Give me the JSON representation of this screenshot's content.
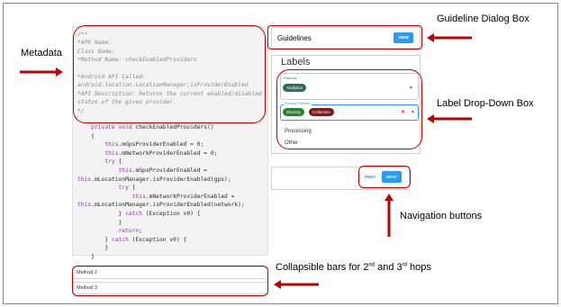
{
  "metadata_code_lines": [
    "/**",
    "*APK Name:",
    "Class Name:",
    "*Method Name: checkEnabledProviders",
    "",
    "*Android API Called:",
    "android.location.LocationManager;isProviderEnabled",
    "*API Description: Returns the current enabled/disabled",
    "status of the given provider.",
    "*/"
  ],
  "code_body_lines": [
    "    private void checkEnabledProviders()",
    "    {",
    "        this.mGpsProviderEnabled = 0;",
    "        this.mNetworkProviderEnabled = 0;",
    "        try {",
    "            this.mGpsProviderEnabled =",
    "this.mLocationManager.isProviderEnabled(gps);",
    "            try {",
    "                this.mNetworkProviderEnabled =",
    "this.mLocationManager.isProviderEnabled(network);",
    "            } catch (Exception v0) {",
    "            }",
    "            return;",
    "        } catch (Exception v0) {",
    "        }",
    "    }"
  ],
  "method_bars": [
    "Method 2",
    "Method 3"
  ],
  "guidelines": {
    "title": "Guidelines",
    "view_label": "VIEW"
  },
  "labels_panel": {
    "title": "Labels",
    "purpose": {
      "caption": "Purpose",
      "chip": "Analytics"
    },
    "privacy_practice": {
      "caption": "Privacy Practice",
      "chips": [
        "Sharing",
        "Collection"
      ],
      "clear": "✕"
    },
    "options": [
      "Processing",
      "Other"
    ]
  },
  "navigation": {
    "prev_label": "PREV",
    "next_label": "NEXT"
  },
  "annotations": {
    "metadata": "Metadata",
    "guideline_box": "Guideline Dialog Box",
    "label_dropdown": "Label Drop-Down Box",
    "navigation": "Navigation buttons",
    "collapsible_prefix": "Collapsible bars for 2",
    "collapsible_sup1": "nd",
    "collapsible_mid": " and 3",
    "collapsible_sup2": "rd",
    "collapsible_suffix": " hops"
  },
  "colors": {
    "accent_blue": "#2b9af3",
    "annotation_red": "#c00000",
    "chip_analytics": "#2f6b61",
    "chip_sharing": "#2e7d32",
    "chip_collection": "#7b1a1a"
  }
}
